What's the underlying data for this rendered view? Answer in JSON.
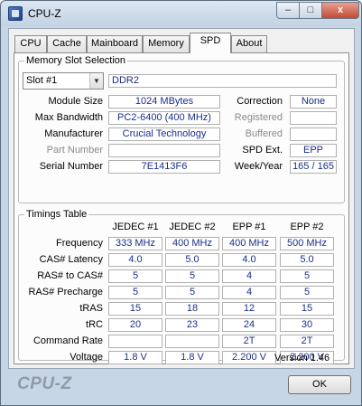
{
  "window": {
    "title": "CPU-Z",
    "controls": {
      "minimize": "–",
      "maximize": "□",
      "close": "x"
    }
  },
  "tabs": [
    "CPU",
    "Cache",
    "Mainboard",
    "Memory",
    "SPD",
    "About"
  ],
  "active_tab": "SPD",
  "slot_section": {
    "title": "Memory Slot Selection",
    "slot_value": "Slot #1",
    "memory_type": "DDR2",
    "module_size_label": "Module Size",
    "module_size": "1024 MBytes",
    "max_bandwidth_label": "Max Bandwidth",
    "max_bandwidth": "PC2-6400 (400 MHz)",
    "manufacturer_label": "Manufacturer",
    "manufacturer": "Crucial Technology",
    "part_number_label": "Part Number",
    "part_number": "",
    "serial_number_label": "Serial Number",
    "serial_number": "7E1413F6",
    "correction_label": "Correction",
    "correction": "None",
    "registered_label": "Registered",
    "registered": "",
    "buffered_label": "Buffered",
    "buffered": "",
    "spd_ext_label": "SPD Ext.",
    "spd_ext": "EPP",
    "week_year_label": "Week/Year",
    "week_year": "165 / 165"
  },
  "timings": {
    "title": "Timings Table",
    "columns": [
      "JEDEC #1",
      "JEDEC #2",
      "EPP #1",
      "EPP #2"
    ],
    "rows": [
      {
        "label": "Frequency",
        "values": [
          "333 MHz",
          "400 MHz",
          "400 MHz",
          "500 MHz"
        ]
      },
      {
        "label": "CAS# Latency",
        "values": [
          "4.0",
          "5.0",
          "4.0",
          "5.0"
        ]
      },
      {
        "label": "RAS# to CAS#",
        "values": [
          "5",
          "5",
          "4",
          "5"
        ]
      },
      {
        "label": "RAS# Precharge",
        "values": [
          "5",
          "5",
          "4",
          "5"
        ]
      },
      {
        "label": "tRAS",
        "values": [
          "15",
          "18",
          "12",
          "15"
        ]
      },
      {
        "label": "tRC",
        "values": [
          "20",
          "23",
          "24",
          "30"
        ]
      },
      {
        "label": "Command Rate",
        "values": [
          "",
          "",
          "2T",
          "2T"
        ]
      },
      {
        "label": "Voltage",
        "values": [
          "1.8 V",
          "1.8 V",
          "2.200 V",
          "2.200 V"
        ]
      }
    ]
  },
  "footer": {
    "version": "Version 1.46",
    "brand": "CPU-Z",
    "ok_label": "OK"
  }
}
